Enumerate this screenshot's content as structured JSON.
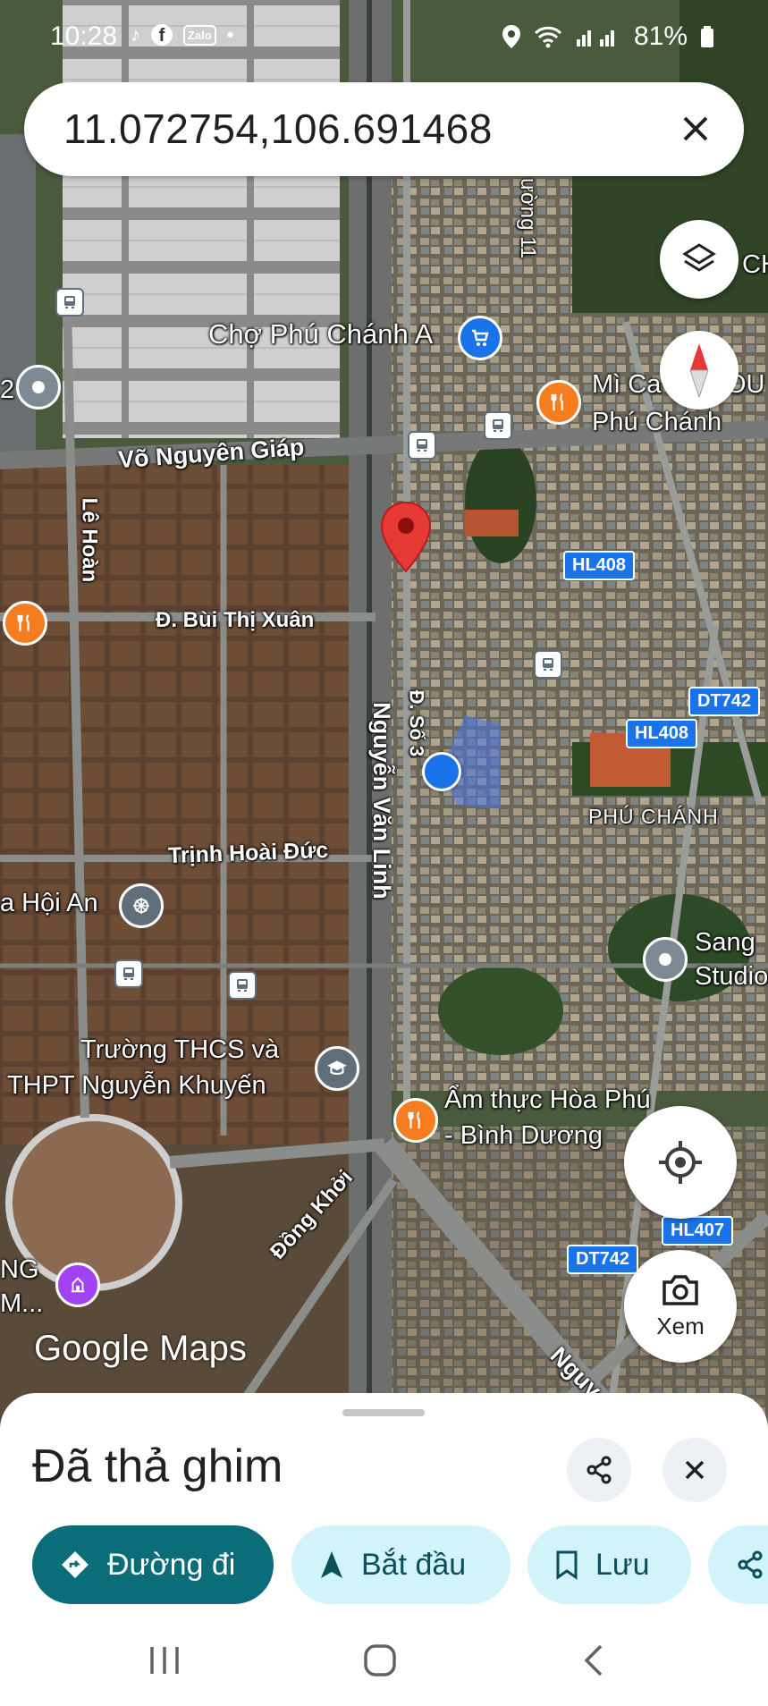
{
  "status_bar": {
    "time": "10:28",
    "app_icons": [
      "tiktok-icon",
      "facebook-icon",
      "zalo-icon",
      "dot-icon"
    ],
    "zalo_text": "Zalo",
    "battery": "81%"
  },
  "search": {
    "value": "11.072754,106.691468"
  },
  "map_labels": {
    "market": "Chợ Phú Chánh A",
    "noodle_line1": "Mì Ca",
    "noodle_tail": "OU",
    "noodle_line2": "Phú Chánh",
    "vo_nguyen_giap": "Võ Nguyên Giáp",
    "le_hoan": "Lê Hoàn",
    "bui_thi_xuan": "Đ. Bùi Thị Xuân",
    "nguyen_van_linh": "Nguyễn Văn Linh",
    "so3": "Đ. Số 3",
    "trinh_hoai_duc": "Trịnh Hoài Đức",
    "hoi_an": "a Hội An",
    "phu_chanh": "PHÚ CHÁNH",
    "studio_line1": "Sang",
    "studio_line2": "Studio",
    "school_line1": "Trường THCS và",
    "school_line2": "THPT Nguyễn Khuyến",
    "food_line1": "Ẩm thực Hòa Phú",
    "food_line2": "- Bình Dương",
    "dong_khoi": "Đồng Khởi",
    "nguyen_bottom": "Nguy",
    "ng": "NG",
    "m": "M...",
    "duong11": "ường 11",
    "ch": "CH",
    "left_2": "2",
    "hl408_a": "HL408",
    "hl408_b": "HL408",
    "dt742_a": "DT742",
    "dt742_b": "DT742",
    "hl407": "HL407",
    "google_maps": "Google Maps"
  },
  "map_controls": {
    "layers_icon": "layers-icon",
    "compass_icon": "compass-icon",
    "location_icon": "my-location-icon",
    "streetview_label": "Xem"
  },
  "sheet": {
    "title": "Đã thả ghim",
    "chips": [
      {
        "label": "Đường đi",
        "icon": "directions-icon"
      },
      {
        "label": "Bắt đầu",
        "icon": "navigation-icon"
      },
      {
        "label": "Lưu",
        "icon": "bookmark-icon"
      }
    ]
  },
  "colors": {
    "primary_chip": "#0b6d7a",
    "secondary_chip": "#d3f3fb",
    "pin_red": "#e53935",
    "poi_orange": "#f57c1f",
    "shield_blue": "#1a73e8"
  }
}
